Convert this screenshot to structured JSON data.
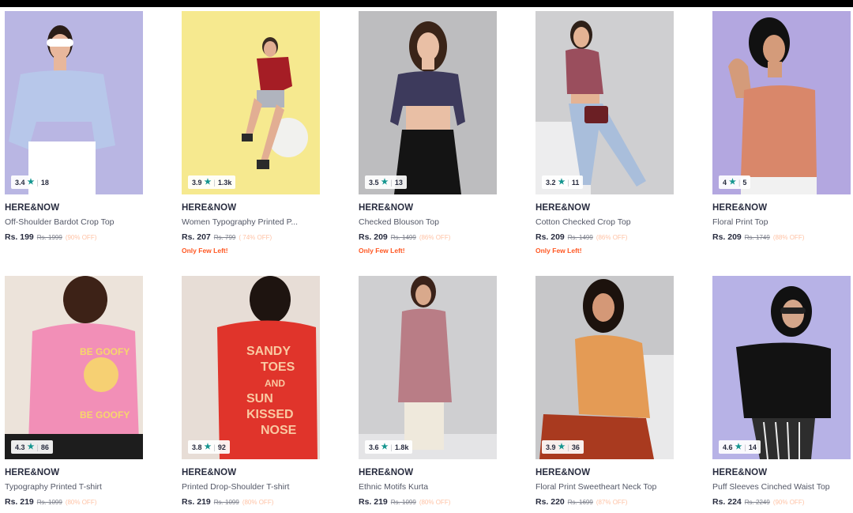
{
  "products": [
    {
      "brand": "HERE&NOW",
      "name": "Off-Shoulder Bardot Crop Top",
      "price": "Rs. 199",
      "mrp": "Rs. 1999",
      "off": "(90% OFF)",
      "rating": "3.4",
      "count": "18",
      "few": "",
      "bg": "#b9b6e3",
      "cloth": "#b7c7ea",
      "accent": "#ffffff"
    },
    {
      "brand": "HERE&NOW",
      "name": "Women Typography Printed P...",
      "price": "Rs. 207",
      "mrp": "Rs. 799",
      "off": "( 74% OFF)",
      "rating": "3.9",
      "count": "1.3k",
      "few": "Only Few Left!",
      "bg": "#f6e98f",
      "cloth": "#a51d25",
      "accent": "#f1f1ee"
    },
    {
      "brand": "HERE&NOW",
      "name": "Checked Blouson Top",
      "price": "Rs. 209",
      "mrp": "Rs. 1499",
      "off": "(86% OFF)",
      "rating": "3.5",
      "count": "13",
      "few": "Only Few Left!",
      "bg": "#bdbdbf",
      "cloth": "#3d3a5c",
      "accent": "#141414"
    },
    {
      "brand": "HERE&NOW",
      "name": "Cotton Checked Crop Top",
      "price": "Rs. 209",
      "mrp": "Rs. 1499",
      "off": "(86% OFF)",
      "rating": "3.2",
      "count": "11",
      "few": "Only Few Left!",
      "bg": "#cfcfd1",
      "cloth": "#9a4e5d",
      "accent": "#a9bedb"
    },
    {
      "brand": "HERE&NOW",
      "name": "Floral Print Top",
      "price": "Rs. 209",
      "mrp": "Rs. 1749",
      "off": "(88% OFF)",
      "rating": "4",
      "count": "5",
      "few": "",
      "bg": "#b3a7e0",
      "cloth": "#d9876a",
      "accent": "#f1f1f1"
    },
    {
      "brand": "HERE&NOW",
      "name": "Typography Printed T-shirt",
      "price": "Rs. 219",
      "mrp": "Rs. 1099",
      "off": "(80% OFF)",
      "rating": "4.3",
      "count": "86",
      "few": "",
      "bg": "#ece3da",
      "cloth": "#f28fb7",
      "accent": "#1d1d1d"
    },
    {
      "brand": "HERE&NOW",
      "name": "Printed Drop-Shoulder T-shirt",
      "price": "Rs. 219",
      "mrp": "Rs. 1099",
      "off": "(80% OFF)",
      "rating": "3.8",
      "count": "92",
      "few": "",
      "bg": "#e7ddd6",
      "cloth": "#e0342b",
      "accent": "#f9c9a2"
    },
    {
      "brand": "HERE&NOW",
      "name": "Ethnic Motifs Kurta",
      "price": "Rs. 219",
      "mrp": "Rs. 1099",
      "off": "(80% OFF)",
      "rating": "3.6",
      "count": "1.8k",
      "few": "",
      "bg": "#cfcfd1",
      "cloth": "#b97d86",
      "accent": "#efe9dc"
    },
    {
      "brand": "HERE&NOW",
      "name": "Floral Print Sweetheart Neck Top",
      "price": "Rs. 220",
      "mrp": "Rs. 1699",
      "off": "(87% OFF)",
      "rating": "3.9",
      "count": "36",
      "few": "",
      "bg": "#c7c7c9",
      "cloth": "#e49b55",
      "accent": "#a93a1f"
    },
    {
      "brand": "HERE&NOW",
      "name": "Puff Sleeves Cinched Waist Top",
      "price": "Rs. 224",
      "mrp": "Rs. 2249",
      "off": "(90% OFF)",
      "rating": "4.6",
      "count": "14",
      "few": "",
      "bg": "#b7b2e6",
      "cloth": "#121212",
      "accent": "#2d2d2d"
    }
  ]
}
